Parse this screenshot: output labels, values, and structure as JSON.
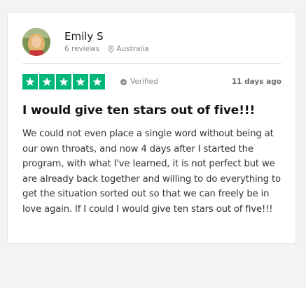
{
  "review": {
    "reviewer_name": "Emily S",
    "reviews_count": "6 reviews",
    "location": "Australia",
    "rating": 5,
    "rating_max": 5,
    "verified_label": "Verified",
    "date": "11 days ago",
    "title": "I would give ten stars out of five!!!",
    "body": "We could not even place a single word without being at our own throats, and now 4 days after I started the program, with what I've learned, it is not perfect but we are already back together and willing to do everything to get the situation sorted out so that we can freely be in love again. If I could I would give ten stars out of five!!!"
  },
  "icons": {
    "avatar": "avatar",
    "location": "location-pin-icon",
    "verified": "verified-check-icon",
    "star": "star-icon"
  },
  "colors": {
    "star_green": "#00b67a",
    "background": "#f3f3f3",
    "card": "#ffffff"
  }
}
